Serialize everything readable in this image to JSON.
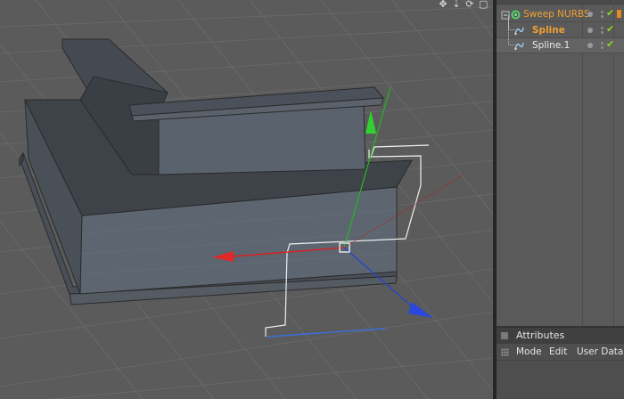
{
  "viewport": {
    "toolbar_icons": [
      "move-icon",
      "zoom-arrow-icon",
      "rotate-icon",
      "maximize-icon"
    ],
    "colors": {
      "background": "#5b5b5b",
      "grid": "#6a6a6a",
      "axis_x": "#e02020",
      "axis_y": "#20d020",
      "axis_z": "#2040e0"
    }
  },
  "object_manager": {
    "items": [
      {
        "label": "Sweep NURBS",
        "color": "#f0a030",
        "icon": "sweep-nurbs-icon"
      },
      {
        "label": "Spline",
        "color": "#f0a030",
        "icon": "spline-icon"
      },
      {
        "label": "Spline.1",
        "color": "#e8e8e8",
        "icon": "spline-icon"
      }
    ]
  },
  "attributes": {
    "title": "Attributes",
    "menu": [
      "Mode",
      "Edit",
      "User Data"
    ]
  }
}
